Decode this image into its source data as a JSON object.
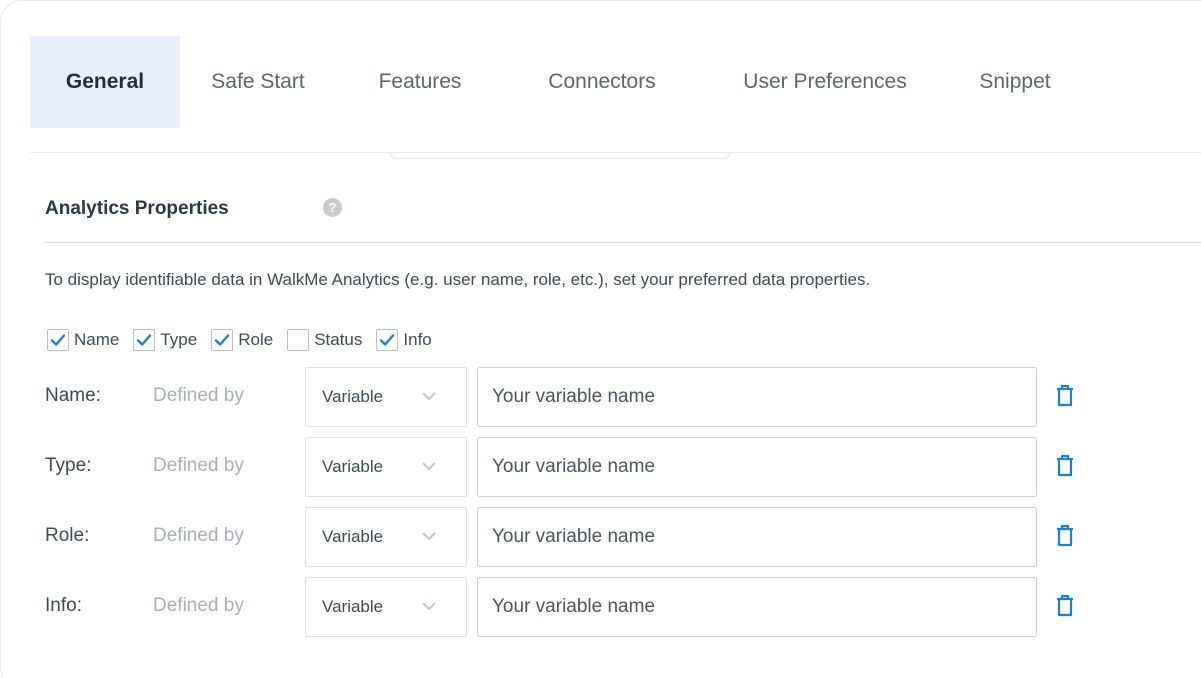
{
  "tabs": [
    {
      "label": "General",
      "active": true
    },
    {
      "label": "Safe Start",
      "active": false
    },
    {
      "label": "Features",
      "active": false
    },
    {
      "label": "Connectors",
      "active": false
    },
    {
      "label": "User Preferences",
      "active": false
    },
    {
      "label": "Snippet",
      "active": false
    }
  ],
  "section": {
    "title": "Analytics Properties",
    "help_icon": "?",
    "description": "To display identifiable data in WalkMe Analytics (e.g. user name, role, etc.), set your preferred data properties."
  },
  "checkboxes": [
    {
      "label": "Name",
      "checked": true
    },
    {
      "label": "Type",
      "checked": true
    },
    {
      "label": "Role",
      "checked": true
    },
    {
      "label": "Status",
      "checked": false
    },
    {
      "label": "Info",
      "checked": true
    }
  ],
  "properties": [
    {
      "label": "Name:",
      "defined_by": "Defined by",
      "source": "Variable",
      "placeholder": "Your variable name"
    },
    {
      "label": "Type:",
      "defined_by": "Defined by",
      "source": "Variable",
      "placeholder": "Your variable name"
    },
    {
      "label": "Role:",
      "defined_by": "Defined by",
      "source": "Variable",
      "placeholder": "Your variable name"
    },
    {
      "label": "Info:",
      "defined_by": "Defined by",
      "source": "Variable",
      "placeholder": "Your variable name"
    }
  ],
  "colors": {
    "accent": "#1a7fd1",
    "active_tab_bg": "#e8eefa"
  },
  "icons": {
    "help": "question-circle-icon",
    "delete": "trash-icon",
    "dropdown": "chevron-down-icon",
    "check": "checkmark-icon"
  }
}
